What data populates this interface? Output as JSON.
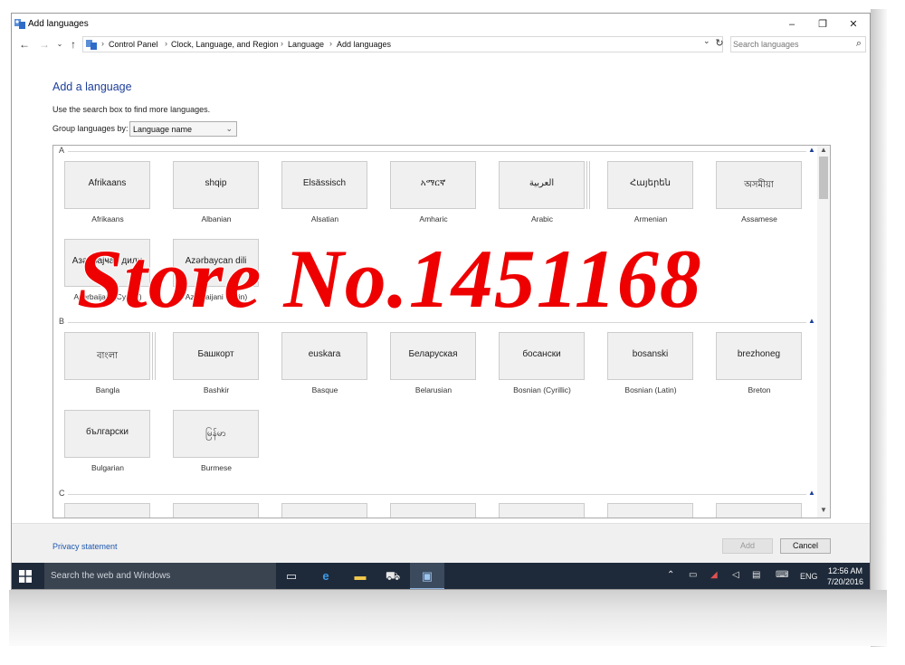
{
  "window": {
    "title": "Add languages",
    "controls": {
      "minimize": "–",
      "maximize": "❐",
      "close": "✕"
    }
  },
  "address_bar": {
    "breadcrumbs": [
      "Control Panel",
      "Clock, Language, and Region",
      "Language",
      "Add languages"
    ],
    "search_placeholder": "Search languages"
  },
  "content": {
    "heading": "Add a language",
    "instruction": "Use the search box to find more languages.",
    "group_by_label": "Group languages by:",
    "group_by_value": "Language name"
  },
  "sections": [
    {
      "letter": "A",
      "tiles": [
        {
          "native": "Afrikaans",
          "name": "Afrikaans",
          "stacked": false
        },
        {
          "native": "shqip",
          "name": "Albanian",
          "stacked": false
        },
        {
          "native": "Elsässisch",
          "name": "Alsatian",
          "stacked": false
        },
        {
          "native": "አማርኛ",
          "name": "Amharic",
          "stacked": false
        },
        {
          "native": "العربية",
          "name": "Arabic",
          "stacked": true
        },
        {
          "native": "Հայերեն",
          "name": "Armenian",
          "stacked": false
        },
        {
          "native": "অসমীয়া",
          "name": "Assamese",
          "stacked": false
        },
        {
          "native": "Азәрбајҹан дили",
          "name": "Azerbaijani (Cyrillic)",
          "stacked": false
        },
        {
          "native": "Azərbaycan dili",
          "name": "Azerbaijani (Latin)",
          "stacked": false
        }
      ]
    },
    {
      "letter": "B",
      "tiles": [
        {
          "native": "বাংলা",
          "name": "Bangla",
          "stacked": true
        },
        {
          "native": "Башкорт",
          "name": "Bashkir",
          "stacked": false
        },
        {
          "native": "euskara",
          "name": "Basque",
          "stacked": false
        },
        {
          "native": "Беларуская",
          "name": "Belarusian",
          "stacked": false
        },
        {
          "native": "босански",
          "name": "Bosnian (Cyrillic)",
          "stacked": false
        },
        {
          "native": "bosanski",
          "name": "Bosnian (Latin)",
          "stacked": false
        },
        {
          "native": "brezhoneg",
          "name": "Breton",
          "stacked": false
        },
        {
          "native": "български",
          "name": "Bulgarian",
          "stacked": false
        },
        {
          "native": "မြန်မာ",
          "name": "Burmese",
          "stacked": false
        }
      ]
    },
    {
      "letter": "C",
      "tiles": []
    }
  ],
  "footer": {
    "privacy": "Privacy statement",
    "add": "Add",
    "cancel": "Cancel"
  },
  "taskbar": {
    "search_placeholder": "Search the web and Windows",
    "language": "ENG",
    "time": "12:56 AM",
    "date": "7/20/2016"
  },
  "watermark": "Store No.1451168",
  "colors": {
    "heading": "#1e3f9a",
    "link": "#1e58b0",
    "taskbar": "#1e2a3a",
    "watermark": "#ee0000"
  }
}
